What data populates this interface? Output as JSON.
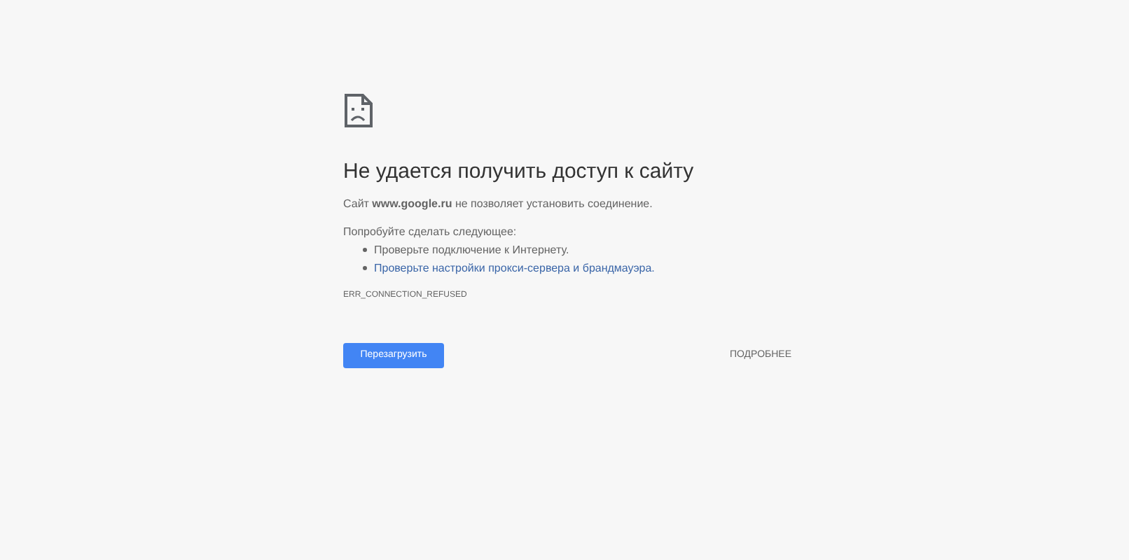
{
  "heading": "Не удается получить доступ к сайту",
  "message": "Сайт **www.google.ru** не позволяет установить соединение.",
  "suggestions_title": "Попробуйте сделать следующее:",
  "suggestions": [
    {
      "kind": "text",
      "text": "Проверьте подключение к Интернету."
    },
    {
      "kind": "link",
      "text": "Проверьте настройки прокси-сервера и брандмауэра."
    }
  ],
  "error_code": "ERR_CONNECTION_REFUSED",
  "reload_button": "Перезагрузить",
  "details_button": "ПОДРОБНЕЕ"
}
